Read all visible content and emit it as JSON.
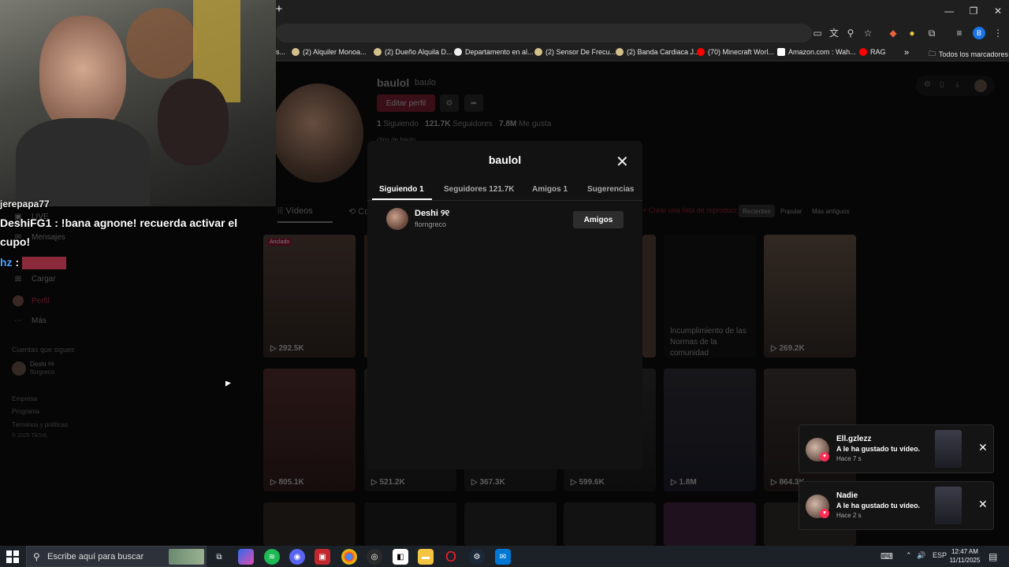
{
  "browser": {
    "bookmarks": [
      {
        "label": "s..."
      },
      {
        "label": "(2) Alquiler Monoa..."
      },
      {
        "label": "(2) Dueño Alquila D..."
      },
      {
        "label": "Departamento en al..."
      },
      {
        "label": "(2) Sensor De Frecu..."
      },
      {
        "label": "(2) Banda Cardiaca J..."
      },
      {
        "label": "(70) Minecraft Worl..."
      },
      {
        "label": "Amazon.com : Wah..."
      },
      {
        "label": "RAG"
      }
    ],
    "bookmarks_overflow": "»",
    "all_bookmarks": "Todos los marcadores",
    "profile_initial": "B",
    "window_controls": {
      "minimize": "—",
      "restore": "❐",
      "close": "✕"
    },
    "new_tab": "+"
  },
  "stream_chat": [
    {
      "user": "jerepapa77",
      "text": ""
    },
    {
      "user": "DeshiFG1",
      "text": " : !bana agnone! recuerda activar el"
    },
    {
      "user": "",
      "text": "cupo!"
    },
    {
      "user": "hz",
      "text": " :"
    }
  ],
  "sidebar": {
    "items": [
      {
        "label": "LIVE",
        "icon": "live-icon"
      },
      {
        "label": "Mensajes",
        "icon": "messages-icon"
      },
      {
        "label": "Cargar",
        "icon": "upload-icon"
      },
      {
        "label": "Perfil",
        "icon": "profile-icon"
      },
      {
        "label": "Más",
        "icon": "more-icon"
      }
    ],
    "following_title": "Cuentas que sigues",
    "following": [
      {
        "name": "Deshi ୨୧",
        "handle": "florgreco"
      }
    ],
    "footer": [
      "Empresa",
      "Programa",
      "Términos y políticas",
      "© 2025 TikTok"
    ]
  },
  "profile": {
    "name": "baulol",
    "handle": "baulo",
    "edit_label": "Editar perfil",
    "stats": {
      "following": "1",
      "following_label": "Siguiendo",
      "followers": "121.7K",
      "followers_label": "Seguidores",
      "likes": "7.8M",
      "likes_label": "Me gusta"
    },
    "bio": "clips de baulo",
    "tabs": [
      "Vídeos",
      "Co"
    ],
    "playlist_label": "+ Crear una lista de reproducción",
    "filters": [
      "Recientes",
      "Popular",
      "Más antiguos"
    ]
  },
  "videos": [
    {
      "views": "292.5K",
      "pinned": "Anclado"
    },
    {
      "views": "269.2K"
    },
    {
      "views": "805.1K"
    },
    {
      "views": "521.2K"
    },
    {
      "views": "367.3K"
    },
    {
      "views": "599.6K"
    },
    {
      "views": "1.8M"
    },
    {
      "views": "864.3K"
    }
  ],
  "blocked_video": "Incumplimiento de las Normas de la comunidad",
  "modal": {
    "title": "baulol",
    "close": "✕",
    "tabs": [
      "Siguiendo 1",
      "Seguidores 121.7K",
      "Amigos 1",
      "Sugerencias"
    ],
    "users": [
      {
        "name": "Deshi ୨୧",
        "handle": "florngreco",
        "button": "Amigos"
      }
    ]
  },
  "notifications": [
    {
      "name": "Ell.gzlezz",
      "message": "A le ha gustado tu vídeo.",
      "time": "Hace 7 s"
    },
    {
      "name": "Nadie",
      "message": "A le ha gustado tu vídeo.",
      "time": "Hace 2 s"
    }
  ],
  "taskbar": {
    "search_placeholder": "Escribe aquí para buscar",
    "language": "ESP",
    "time": "12:47 AM",
    "date": "11/11/2025"
  }
}
